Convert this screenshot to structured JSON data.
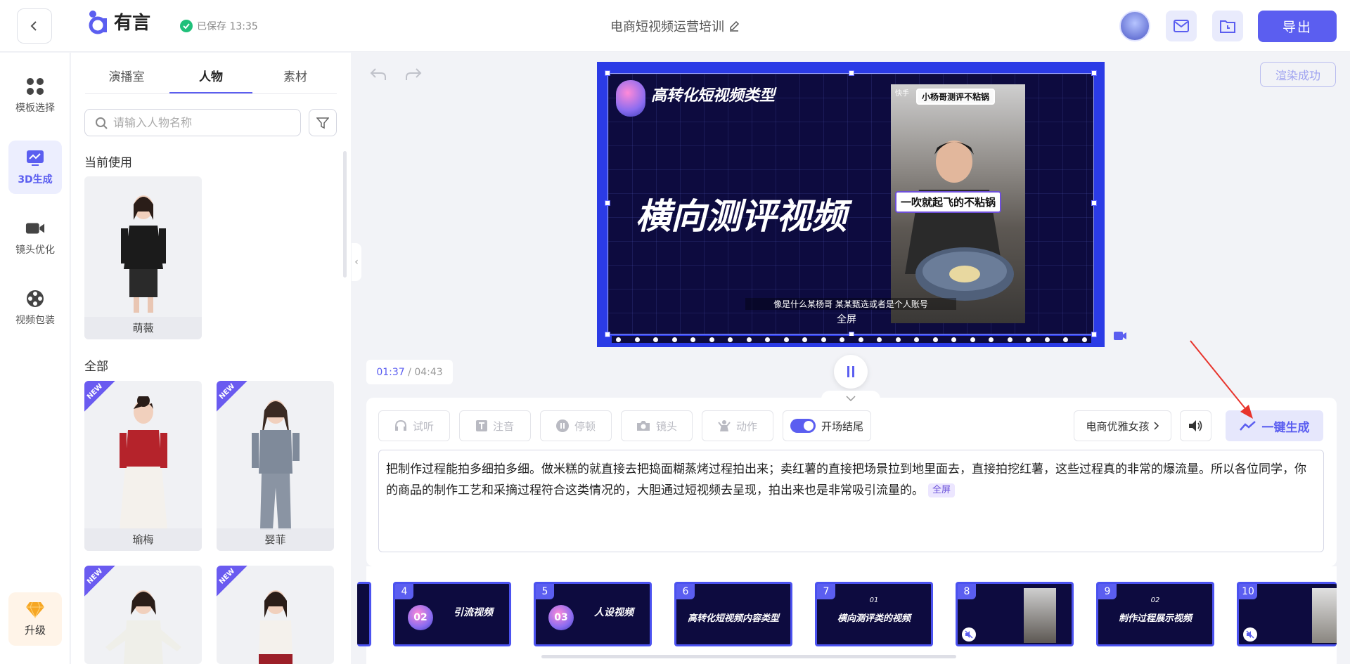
{
  "header": {
    "logo_text": "有言",
    "saved_status": "已保存 13:35",
    "doc_title": "电商短视频运营培训",
    "export_label": "导出"
  },
  "leftnav": {
    "items": [
      {
        "label": "模板选择",
        "icon": "grid-icon"
      },
      {
        "label": "3D生成",
        "icon": "chart-icon"
      },
      {
        "label": "镜头优化",
        "icon": "camera-icon"
      },
      {
        "label": "视频包装",
        "icon": "film-reel-icon"
      }
    ],
    "upgrade_label": "升级"
  },
  "panel": {
    "tabs": [
      "演播室",
      "人物",
      "素材"
    ],
    "active_tab": "人物",
    "search_placeholder": "请输入人物名称",
    "current_heading": "当前使用",
    "all_heading": "全部",
    "current": [
      {
        "name": "萌薇"
      }
    ],
    "characters": [
      {
        "name": "瑜梅",
        "badge": "NEW"
      },
      {
        "name": "婴菲",
        "badge": "NEW"
      },
      {
        "name": "",
        "badge": "NEW"
      },
      {
        "name": "",
        "badge": "NEW"
      }
    ]
  },
  "stage": {
    "render_status": "渲染成功",
    "slide_title": "高转化短视频类型",
    "slide_main_text": "横向测评视频",
    "video_caption_top": "小杨哥测评不粘锅",
    "video_caption_mid": "一吹就起飞的不粘锅",
    "video_brand": "快手",
    "subtitle": "像是什么某杨哥 某某甄选或者是个人账号",
    "fullscreen_label": "全屏",
    "time_current": "01:37",
    "time_total": "04:43"
  },
  "toolbar": {
    "tools": [
      {
        "label": "试听",
        "icon": "headphones-icon"
      },
      {
        "label": "注音",
        "icon": "text-t-icon"
      },
      {
        "label": "停顿",
        "icon": "pause-circle-icon"
      },
      {
        "label": "镜头",
        "icon": "camera-icon"
      },
      {
        "label": "动作",
        "icon": "person-icon"
      }
    ],
    "intro_outro_label": "开场结尾",
    "voice_label": "电商优雅女孩",
    "generate_label": "一键生成"
  },
  "script": {
    "text": "把制作过程能拍多细拍多细。做米糕的就直接去把捣面糊蒸烤过程拍出来；卖红薯的直接把场景拉到地里面去，直接拍挖红薯，这些过程真的非常的爆流量。所以各位同学，你的商品的制作工艺和采摘过程符合这类情况的，大胆通过短视频去呈现，拍出来也是非常吸引流量的。",
    "tag": "全屏"
  },
  "filmstrip": [
    {
      "num": "4",
      "title": "引流视频",
      "badge": "02"
    },
    {
      "num": "5",
      "title": "人设视频",
      "badge": "03"
    },
    {
      "num": "6",
      "title": "高转化短视频内容类型",
      "badge": ""
    },
    {
      "num": "7",
      "title": "横向测评类的视频",
      "badge": "01"
    },
    {
      "num": "8",
      "title": "",
      "badge": ""
    },
    {
      "num": "9",
      "title": "制作过程展示视频",
      "badge": "02"
    },
    {
      "num": "10",
      "title": "",
      "badge": ""
    }
  ],
  "colors": {
    "accent": "#5b5ef0",
    "slide_bg": "#0d0b3f",
    "saved_check": "#20c07a"
  }
}
